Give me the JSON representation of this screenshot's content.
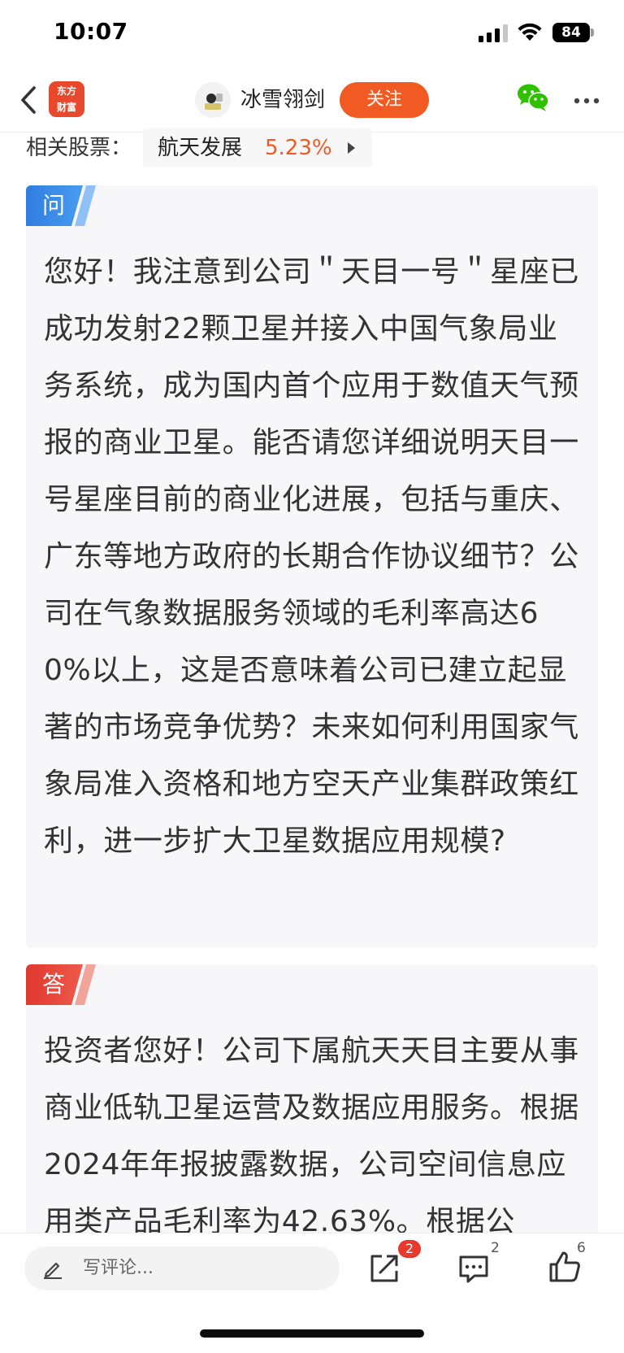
{
  "status_bar": {
    "time": "10:07",
    "battery": "84",
    "icons": [
      "signal-icon",
      "wifi-icon",
      "battery-icon"
    ]
  },
  "nav": {
    "back_icon": "chevron-left-icon",
    "app_logo_line1": "东方",
    "app_logo_line2": "财富",
    "author_name": "冰雪翎剑",
    "follow_label": "关注",
    "wechat_icon": "wechat-icon",
    "more_icon": "more-icon"
  },
  "related": {
    "label": "相关股票：",
    "stock_name": "航天发展",
    "stock_change": "5.23%"
  },
  "question": {
    "tag": "问",
    "text": "您好！我注意到公司＂天目一号＂星座已成功发射22颗卫星并接入中国气象局业务系统，成为国内首个应用于数值天气预报的商业卫星。能否请您详细说明天目一号星座目前的商业化进展，包括与重庆、广东等地方政府的长期合作协议细节？公司在气象数据服务领域的毛利率高达60%以上，这是否意味着公司已建立起显著的市场竞争优势？未来如何利用国家气象局准入资格和地方空天产业集群政策红利，进一步扩大卫星数据应用规模?"
  },
  "answer": {
    "tag": "答",
    "text": "投资者您好！公司下属航天天目主要从事商业低轨卫星运营及数据应用服务。根据2024年年报披露数据，公司空间信息应用类产品毛利率为42.63%。根据公"
  },
  "bottom_bar": {
    "comment_placeholder": "写评论...",
    "share_count": "2",
    "comment_count": "2",
    "like_count": "6"
  },
  "colors": {
    "accent": "#f15a22",
    "question_tag": "#2f7de1",
    "answer_tag": "#e8453c"
  }
}
